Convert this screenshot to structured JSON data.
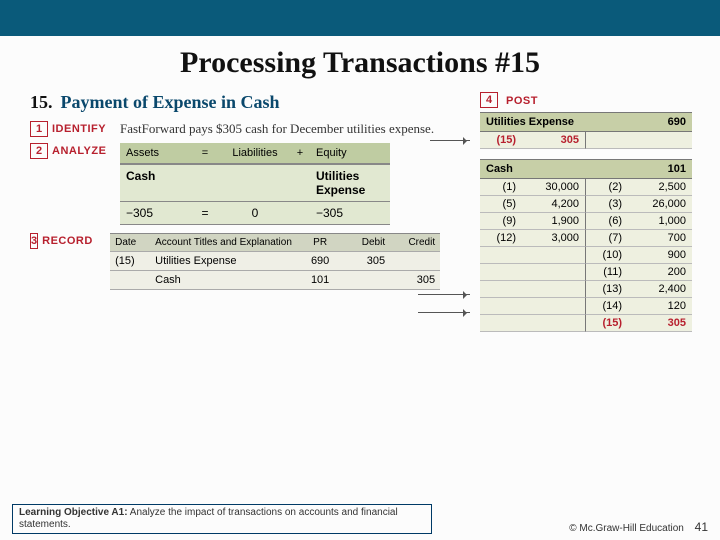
{
  "title": "Processing Transactions #15",
  "problem": {
    "number": "15.",
    "heading": "Payment of Expense in Cash"
  },
  "steps": {
    "s1": {
      "num": "1",
      "label": "IDENTIFY",
      "text": "FastForward pays $305 cash for December utilities expense."
    },
    "s2": {
      "num": "2",
      "label": "ANALYZE"
    },
    "s3": {
      "num": "3",
      "label": "RECORD"
    },
    "s4": {
      "num": "4",
      "label": "POST"
    }
  },
  "analyze": {
    "hdr": {
      "assets": "Assets",
      "eq": "=",
      "liab": "Liabilities",
      "plus": "+",
      "equity": "Equity"
    },
    "sub": {
      "a": "Cash",
      "e": "Utilities Expense"
    },
    "row": {
      "a": "−305",
      "eq": "=",
      "l": "0",
      "plus": "",
      "e": "−305"
    }
  },
  "record": {
    "hdr": {
      "date": "Date",
      "acct": "Account Titles and Explanation",
      "pr": "PR",
      "dr": "Debit",
      "cr": "Credit"
    },
    "r1": {
      "date": "(15)",
      "acct": "Utilities Expense",
      "pr": "690",
      "dr": "305",
      "cr": ""
    },
    "r2": {
      "date": "",
      "acct": "Cash",
      "pr": "101",
      "dr": "",
      "cr": "305"
    }
  },
  "ledgers": {
    "utilities": {
      "title": "Utilities Expense",
      "acctno": "690",
      "rows": [
        {
          "lref": "(15)",
          "lval": "305",
          "rref": "",
          "rval": "",
          "red": true
        }
      ]
    },
    "cash": {
      "title": "Cash",
      "acctno": "101",
      "rows": [
        {
          "lref": "(1)",
          "lval": "30,000",
          "rref": "(2)",
          "rval": "2,500"
        },
        {
          "lref": "(5)",
          "lval": "4,200",
          "rref": "(3)",
          "rval": "26,000"
        },
        {
          "lref": "(9)",
          "lval": "1,900",
          "rref": "(6)",
          "rval": "1,000"
        },
        {
          "lref": "(12)",
          "lval": "3,000",
          "rref": "(7)",
          "rval": "700"
        },
        {
          "lref": "",
          "lval": "",
          "rref": "(10)",
          "rval": "900"
        },
        {
          "lref": "",
          "lval": "",
          "rref": "(11)",
          "rval": "200"
        },
        {
          "lref": "",
          "lval": "",
          "rref": "(13)",
          "rval": "2,400"
        },
        {
          "lref": "",
          "lval": "",
          "rref": "(14)",
          "rval": "120"
        },
        {
          "lref": "",
          "lval": "",
          "rref": "(15)",
          "rval": "305",
          "red": true
        }
      ]
    }
  },
  "footer": {
    "lo_label": "Learning Objective A1:",
    "lo_text": " Analyze the impact of transactions on accounts and financial statements.",
    "copyright": "© Mc.Graw-Hill Education",
    "page": "41"
  },
  "chart_data": {
    "type": "table",
    "title": "Transaction 15 — Payment of Expense in Cash",
    "journal_entry": {
      "debits": [
        {
          "account": "Utilities Expense",
          "pr": 690,
          "amount": 305
        }
      ],
      "credits": [
        {
          "account": "Cash",
          "pr": 101,
          "amount": 305
        }
      ]
    },
    "t_accounts": {
      "Utilities Expense (690)": {
        "debits": [
          {
            "ref": 15,
            "amt": 305
          }
        ],
        "credits": []
      },
      "Cash (101)": {
        "debits": [
          {
            "ref": 1,
            "amt": 30000
          },
          {
            "ref": 5,
            "amt": 4200
          },
          {
            "ref": 9,
            "amt": 1900
          },
          {
            "ref": 12,
            "amt": 3000
          }
        ],
        "credits": [
          {
            "ref": 2,
            "amt": 2500
          },
          {
            "ref": 3,
            "amt": 26000
          },
          {
            "ref": 6,
            "amt": 1000
          },
          {
            "ref": 7,
            "amt": 700
          },
          {
            "ref": 10,
            "amt": 900
          },
          {
            "ref": 11,
            "amt": 200
          },
          {
            "ref": 13,
            "amt": 2400
          },
          {
            "ref": 14,
            "amt": 120
          },
          {
            "ref": 15,
            "amt": 305
          }
        ]
      }
    },
    "accounting_equation": {
      "assets": -305,
      "liabilities": 0,
      "equity": -305
    }
  }
}
